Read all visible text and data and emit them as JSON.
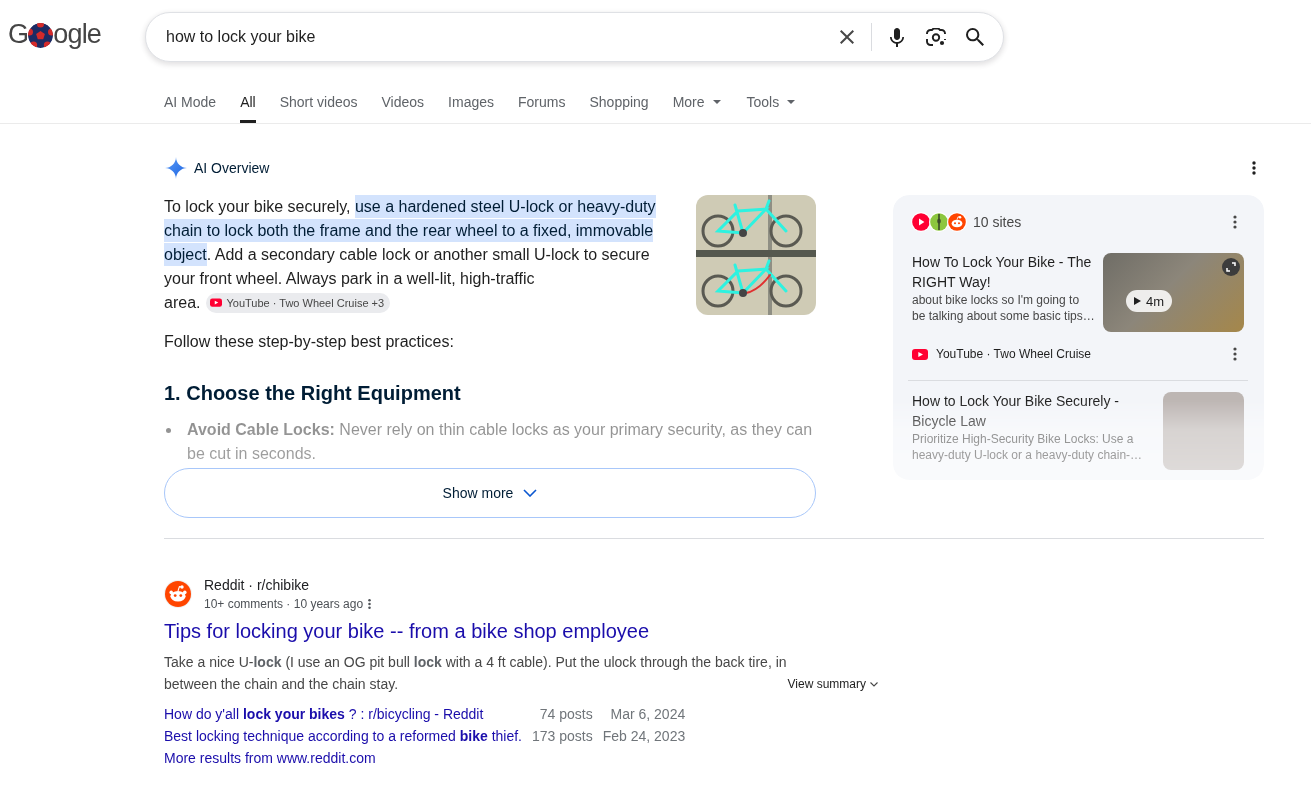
{
  "logo": {
    "before_icon": "G",
    "after_icon": "ogle"
  },
  "search": {
    "value": "how to lock your bike"
  },
  "tabs": [
    {
      "label": "AI Mode",
      "selected": false,
      "dropdown": false
    },
    {
      "label": "All",
      "selected": true,
      "dropdown": false
    },
    {
      "label": "Short videos",
      "selected": false,
      "dropdown": false
    },
    {
      "label": "Videos",
      "selected": false,
      "dropdown": false
    },
    {
      "label": "Images",
      "selected": false,
      "dropdown": false
    },
    {
      "label": "Forums",
      "selected": false,
      "dropdown": false
    },
    {
      "label": "Shopping",
      "selected": false,
      "dropdown": false
    },
    {
      "label": "More",
      "selected": false,
      "dropdown": true
    },
    {
      "label": "Tools",
      "selected": false,
      "dropdown": true
    }
  ],
  "ai_overview": {
    "title": "AI Overview",
    "summary": [
      {
        "text": "To lock your bike securely, ",
        "highlighted": false
      },
      {
        "text": "use a hardened steel U-lock or heavy-duty chain to lock both the frame and the rear wheel to a fixed, immovable object",
        "highlighted": true
      },
      {
        "text": ". Add a secondary cable lock or another small U-lock to secure your front wheel. Always park in a well-lit, high-traffic area.",
        "highlighted": false
      }
    ],
    "citation": "YouTube · Two Wheel Cruise +3",
    "intro": "Follow these step-by-step best practices:",
    "heading": "1. Choose the Right Equipment",
    "bullets": [
      "**Avoid Cable Locks:** Never rely on thin cable locks as your primary security, as they can be cut in seconds."
    ],
    "show_more": "Show more"
  },
  "sources": {
    "count": "10 sites",
    "items": [
      {
        "kind": "video",
        "title": "How To Lock Your Bike - The RIGHT Way!",
        "snippet": "about bike locks so I'm going to be talking about some basic tips…",
        "duration": "4m",
        "source": "YouTube · Two Wheel Cruise"
      },
      {
        "kind": "article",
        "title": "How to Lock Your Bike Securely - Bicycle Law",
        "snippet": "Prioritize High-Security Bike Locks: Use a heavy-duty U-lock or a heavy-duty chain-…"
      }
    ]
  },
  "results": [
    {
      "site": "Reddit · r/chibike",
      "meta": "10+ comments · 10 years ago",
      "title": "Tips for locking your bike -- from a bike shop employee",
      "snippet": "Take a nice U-**lock** (I use an OG pit bull **lock** with a 4 ft cable). Put the ulock through the back tire, in between the chain and the chain stay.",
      "view_summary": "View summary",
      "sublinks": [
        {
          "title": "How do y'all **lock your bikes** ? : r/bicycling - Reddit",
          "posts": "74 posts",
          "date": "Mar 6, 2024"
        },
        {
          "title": "Best locking technique according to a reformed **bike** thief.",
          "posts": "173 posts",
          "date": "Feb 24, 2023"
        }
      ],
      "more": "More results from www.reddit.com"
    }
  ]
}
